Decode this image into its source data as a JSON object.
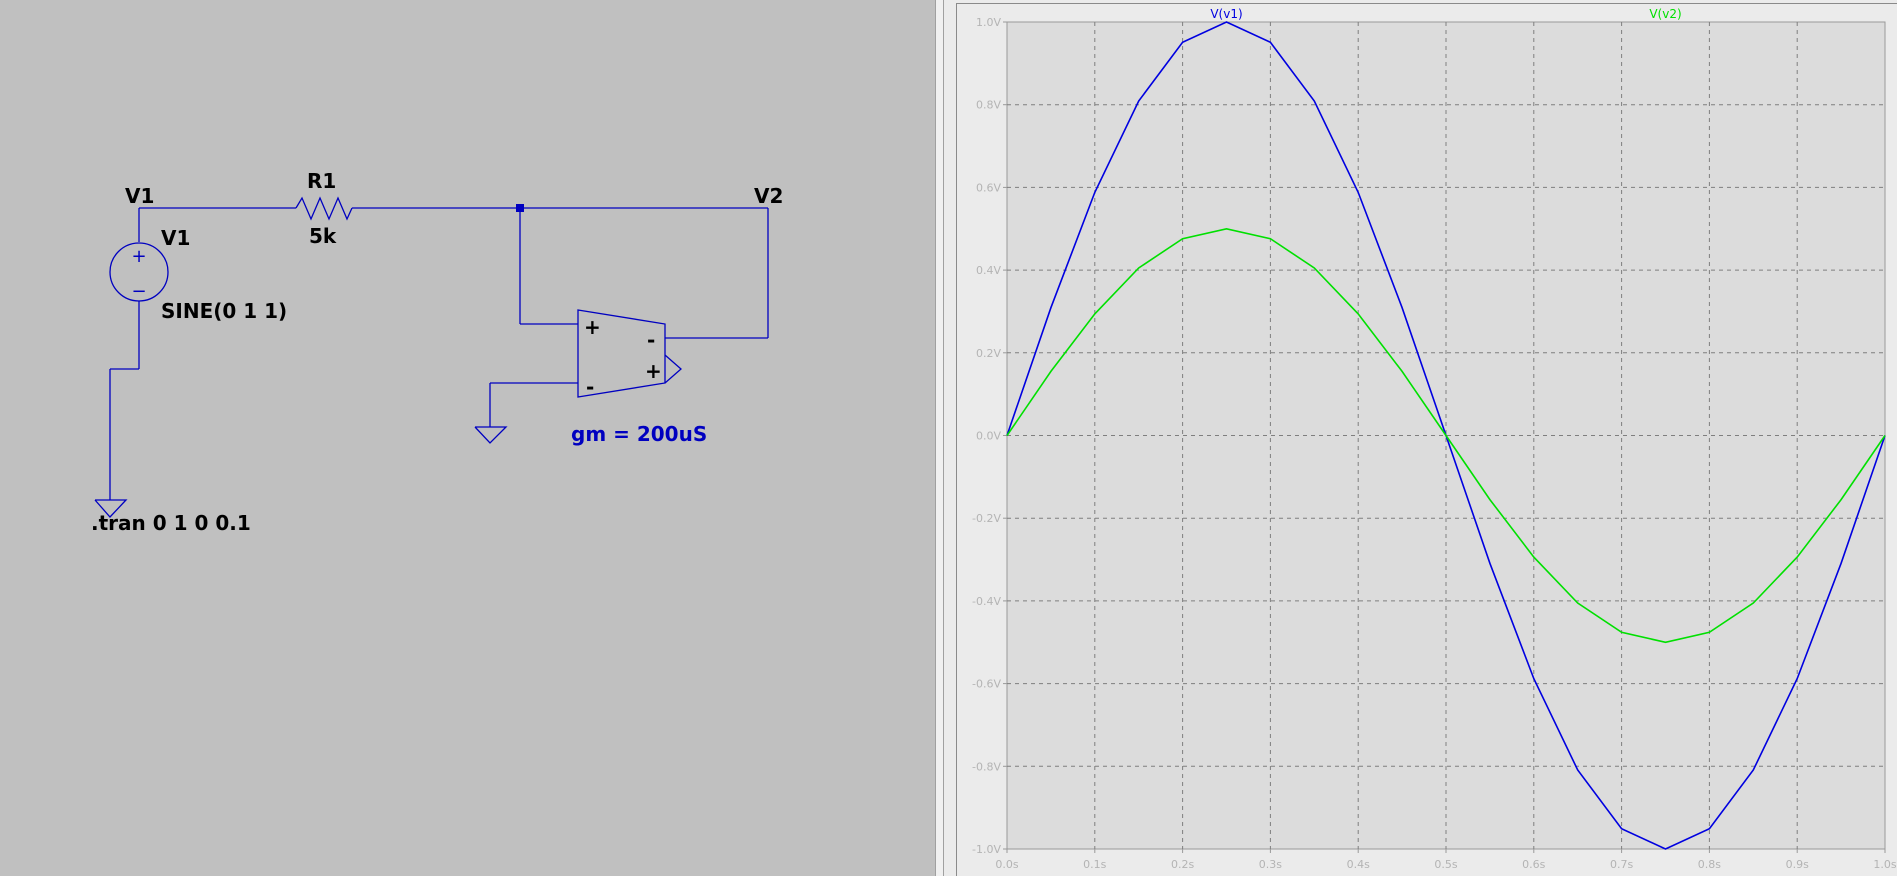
{
  "schematic": {
    "wire_color": "#0000c0",
    "net_labels": {
      "v1": "V1",
      "v2": "V2"
    },
    "resistor": {
      "name": "R1",
      "value": "5k"
    },
    "source": {
      "name": "V1",
      "value": "SINE(0 1 1)"
    },
    "ota": {
      "pin_plus_in": "+",
      "pin_minus_in": "-",
      "pin_minus_out": "-",
      "pin_plus_out": "+",
      "param": "gm = 200uS"
    },
    "directive": ".tran 0 1 0 0.1"
  },
  "waveform": {
    "background": "#dcdcdc",
    "grid_color": "#7f7f7f",
    "chart_data": {
      "type": "line",
      "xlim": [
        0,
        1
      ],
      "ylim": [
        -1,
        1
      ],
      "grid": true,
      "x_ticks": [
        "0.0s",
        "0.1s",
        "0.2s",
        "0.3s",
        "0.4s",
        "0.5s",
        "0.6s",
        "0.7s",
        "0.8s",
        "0.9s",
        "1.0s"
      ],
      "y_ticks": [
        "1.0V",
        "0.8V",
        "0.6V",
        "0.4V",
        "0.2V",
        "0.0V",
        "-0.2V",
        "-0.4V",
        "-0.6V",
        "-0.8V",
        "-1.0V"
      ],
      "series": [
        {
          "name": "V(v1)",
          "color": "#0000e0",
          "x": [
            0,
            0.05,
            0.1,
            0.15,
            0.2,
            0.25,
            0.3,
            0.35,
            0.4,
            0.45,
            0.5,
            0.55,
            0.6,
            0.65,
            0.7,
            0.75,
            0.8,
            0.85,
            0.9,
            0.95,
            1.0
          ],
          "values": [
            0,
            0.309,
            0.588,
            0.809,
            0.951,
            1.0,
            0.951,
            0.809,
            0.588,
            0.309,
            0,
            -0.309,
            -0.588,
            -0.809,
            -0.951,
            -1.0,
            -0.951,
            -0.809,
            -0.588,
            -0.309,
            0
          ]
        },
        {
          "name": "V(v2)",
          "color": "#00e000",
          "x": [
            0,
            0.05,
            0.1,
            0.15,
            0.2,
            0.25,
            0.3,
            0.35,
            0.4,
            0.45,
            0.5,
            0.55,
            0.6,
            0.65,
            0.7,
            0.75,
            0.8,
            0.85,
            0.9,
            0.95,
            1.0
          ],
          "values": [
            0,
            0.155,
            0.294,
            0.405,
            0.476,
            0.5,
            0.476,
            0.405,
            0.294,
            0.155,
            0,
            -0.155,
            -0.294,
            -0.405,
            -0.476,
            -0.5,
            -0.476,
            -0.405,
            -0.294,
            -0.155,
            0
          ]
        }
      ]
    }
  }
}
